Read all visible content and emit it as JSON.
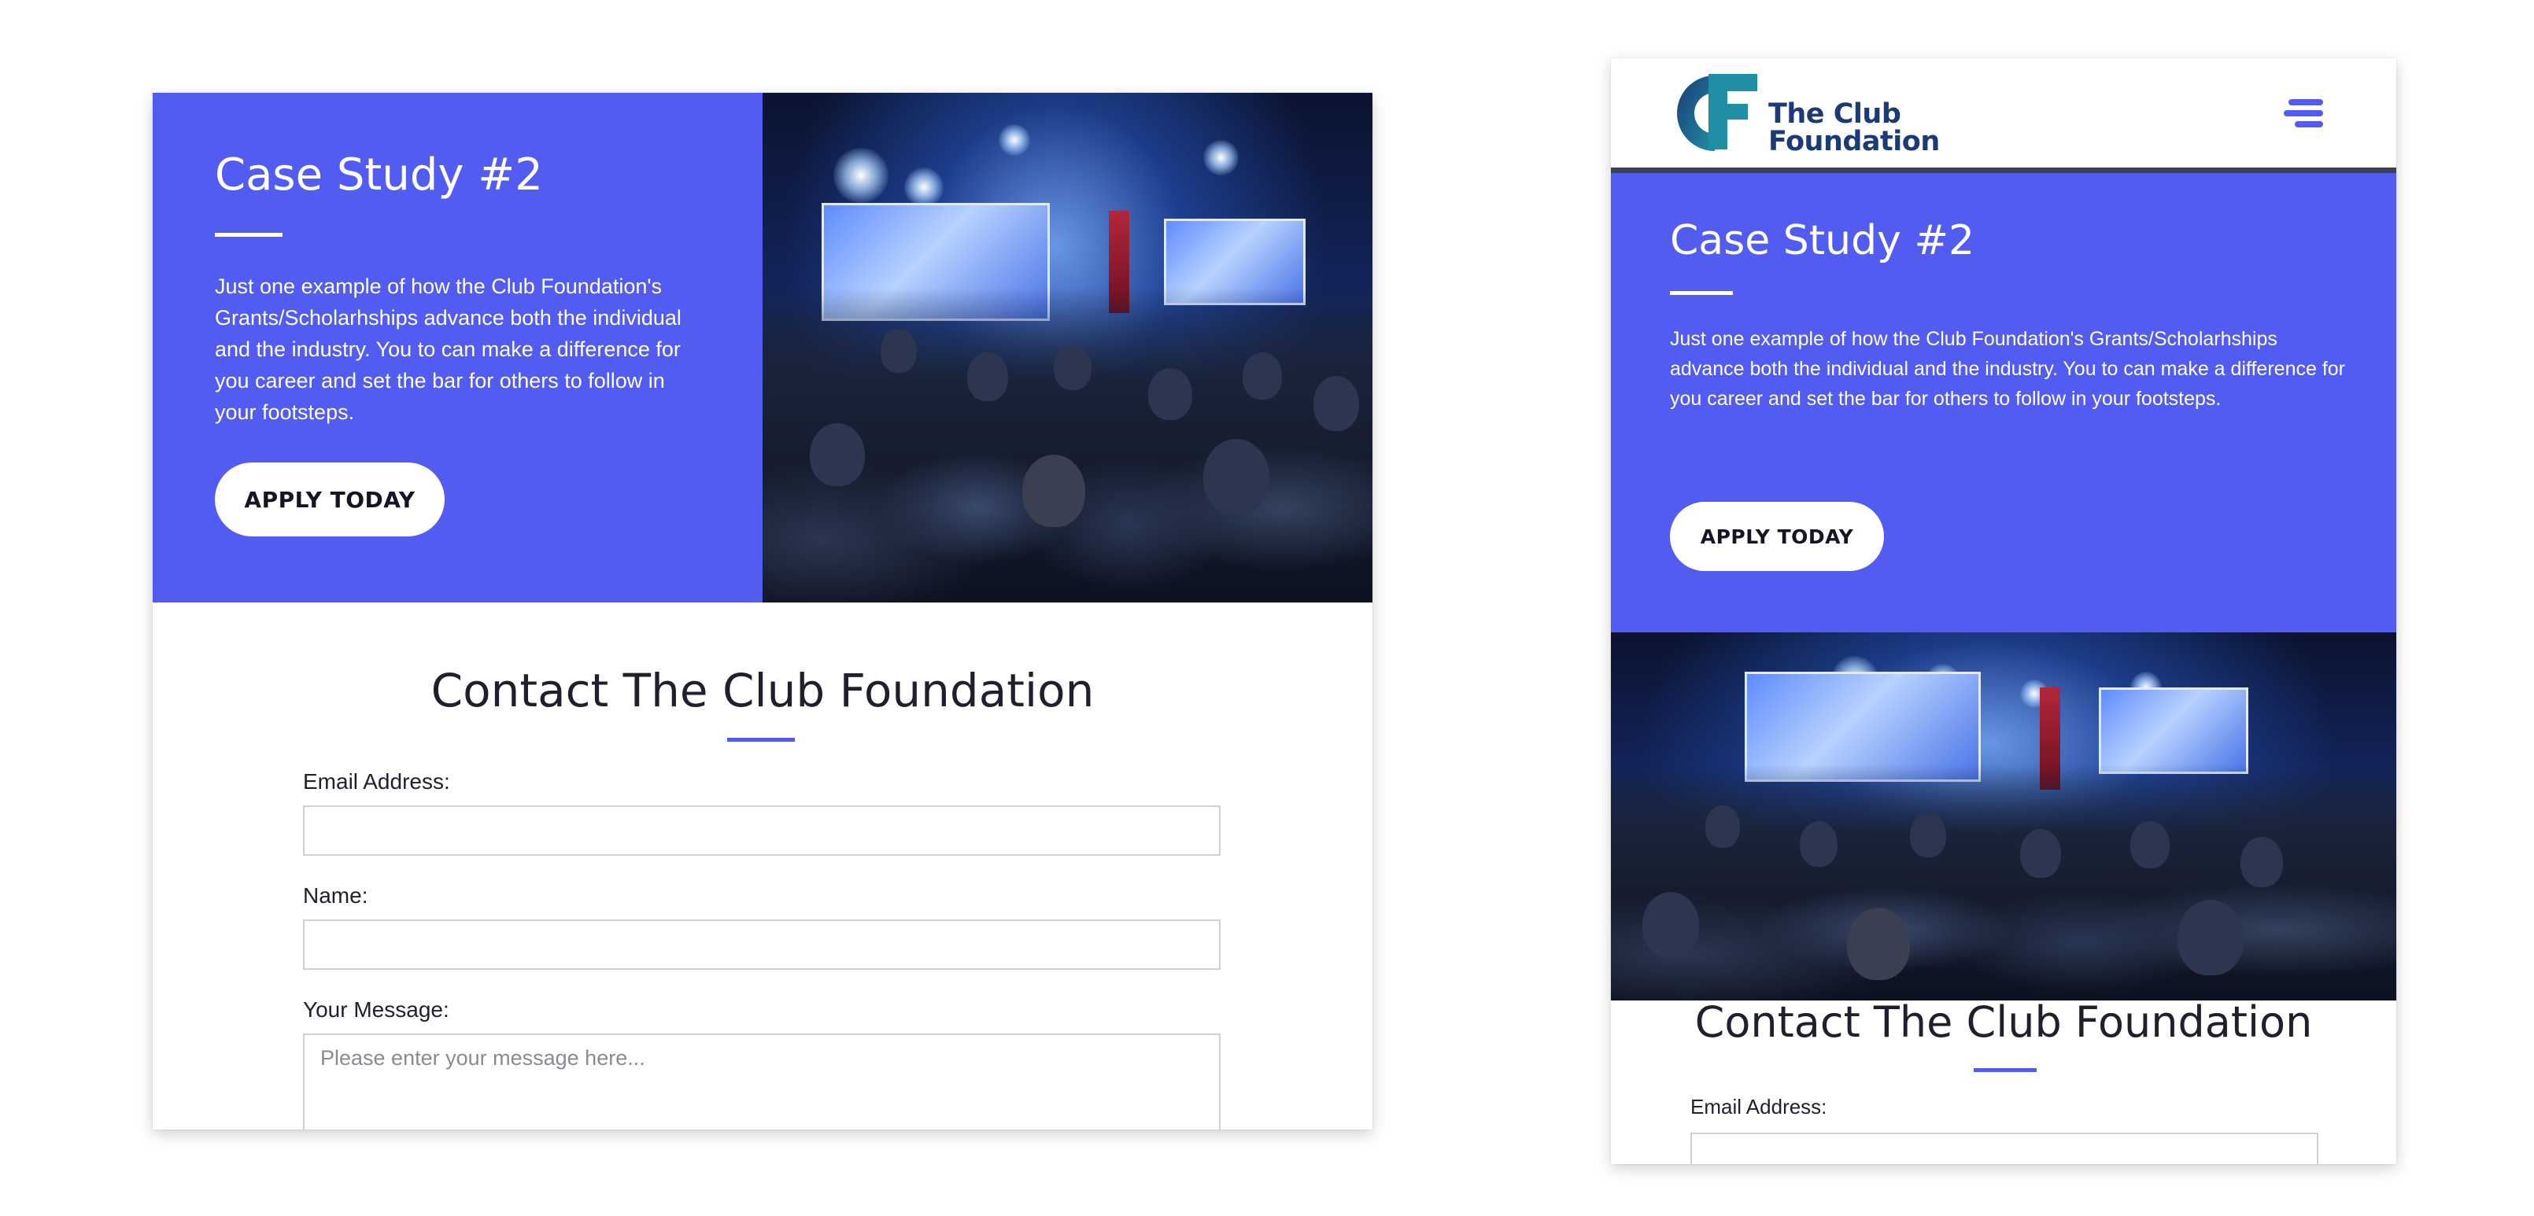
{
  "desktop_view": {
    "hero": {
      "title": "Case Study #2",
      "description": "Just one example of how the Club Foundation's Grants/Scholarhships advance both the individual and the industry. You to can make a difference for you career and set the bar for others to follow in your footsteps.",
      "cta_label": "APPLY TODAY"
    },
    "contact": {
      "title": "Contact The Club Foundation",
      "email_label": "Email Address:",
      "name_label": "Name:",
      "message_label": "Your Message:",
      "message_placeholder": "Please enter your message here..."
    }
  },
  "mobile_view": {
    "header": {
      "logo_line1": "The Club",
      "logo_line2": "Foundation"
    },
    "hero": {
      "title": "Case Study #2",
      "description": "Just one example of how the Club Foundation's Grants/Scholarhships advance both the individual and the industry. You to can make a difference for you career and set the bar for others to follow in your footsteps.",
      "cta_label": "APPLY TODAY"
    },
    "contact": {
      "title": "Contact The Club Foundation",
      "email_label": "Email Address:"
    }
  },
  "colors": {
    "accent": "#535cf0",
    "logo_navy": "#1b3b78",
    "logo_teal": "#1f8fa3",
    "header_border": "#3b4257"
  },
  "icons": {
    "menu": "hamburger-menu-icon",
    "logo": "cf-logo-mark"
  }
}
